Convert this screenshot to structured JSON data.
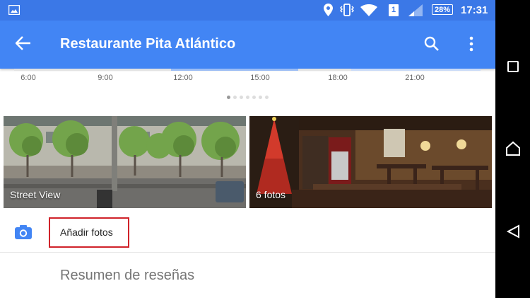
{
  "status_bar": {
    "battery": "28%",
    "sim": "1",
    "time": "17:31",
    "icons": [
      "gallery-icon",
      "location-icon",
      "vibrate-icon",
      "wifi-icon",
      "signal-icon"
    ]
  },
  "app_bar": {
    "title": "Restaurante Pita Atlántico",
    "back_icon": "arrow-back-icon",
    "search_icon": "search-icon",
    "menu_icon": "more-vert-icon"
  },
  "timeline": {
    "labels": [
      "6:00",
      "9:00",
      "12:00",
      "15:00",
      "18:00",
      "21:00"
    ],
    "carousel_dots": 7,
    "active_dot": 0
  },
  "photos": [
    {
      "label": "Street View"
    },
    {
      "label": "6 fotos"
    }
  ],
  "add_photos": {
    "label": "Añadir fotos",
    "icon": "camera-icon"
  },
  "summary": {
    "heading": "Resumen de reseñas"
  },
  "nav_bar": {
    "icons": [
      "recents-icon",
      "home-icon",
      "back-icon"
    ]
  },
  "colors": {
    "status_bar": "#3b78e7",
    "app_bar": "#4285f4",
    "highlight": "#d0232a"
  }
}
